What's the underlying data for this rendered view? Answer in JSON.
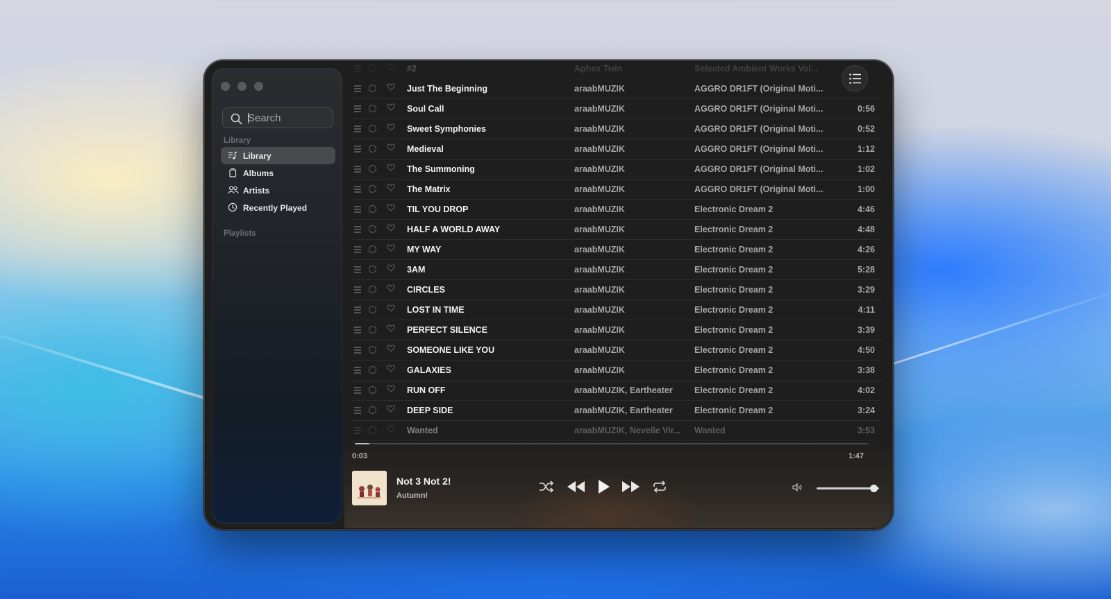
{
  "window": {
    "traffic_lights": [
      "close",
      "minimize",
      "zoom"
    ]
  },
  "sidebar": {
    "search": {
      "placeholder": "Search",
      "value": ""
    },
    "library_heading": "Library",
    "items": [
      {
        "label": "Library",
        "icon": "music-list-icon",
        "active": true
      },
      {
        "label": "Albums",
        "icon": "album-icon",
        "active": false
      },
      {
        "label": "Artists",
        "icon": "artists-icon",
        "active": false
      },
      {
        "label": "Recently Played",
        "icon": "clock-icon",
        "active": false
      }
    ],
    "playlists_heading": "Playlists"
  },
  "tracks": [
    {
      "title": "#2",
      "artist": "Aphex Twin",
      "album": "Selected Ambient Works Vol...",
      "duration": ""
    },
    {
      "title": "Just The Beginning",
      "artist": "araabMUZIK",
      "album": "AGGRO DR1FT (Original Moti...",
      "duration": ""
    },
    {
      "title": "Soul Call",
      "artist": "araabMUZIK",
      "album": "AGGRO DR1FT (Original Moti...",
      "duration": "0:56"
    },
    {
      "title": "Sweet Symphonies",
      "artist": "araabMUZIK",
      "album": "AGGRO DR1FT (Original Moti...",
      "duration": "0:52"
    },
    {
      "title": "Medieval",
      "artist": "araabMUZIK",
      "album": "AGGRO DR1FT (Original Moti...",
      "duration": "1:12"
    },
    {
      "title": "The Summoning",
      "artist": "araabMUZIK",
      "album": "AGGRO DR1FT (Original Moti...",
      "duration": "1:02"
    },
    {
      "title": "The Matrix",
      "artist": "araabMUZIK",
      "album": "AGGRO DR1FT (Original Moti...",
      "duration": "1:00"
    },
    {
      "title": "TIL YOU DROP",
      "artist": "araabMUZIK",
      "album": "Electronic Dream 2",
      "duration": "4:46"
    },
    {
      "title": "HALF A WORLD AWAY",
      "artist": "araabMUZIK",
      "album": "Electronic Dream 2",
      "duration": "4:48"
    },
    {
      "title": "MY WAY",
      "artist": "araabMUZIK",
      "album": "Electronic Dream 2",
      "duration": "4:26"
    },
    {
      "title": "3AM",
      "artist": "araabMUZIK",
      "album": "Electronic Dream 2",
      "duration": "5:28"
    },
    {
      "title": "CIRCLES",
      "artist": "araabMUZIK",
      "album": "Electronic Dream 2",
      "duration": "3:29"
    },
    {
      "title": "LOST IN TIME",
      "artist": "araabMUZIK",
      "album": "Electronic Dream 2",
      "duration": "4:11"
    },
    {
      "title": "PERFECT SILENCE",
      "artist": "araabMUZIK",
      "album": "Electronic Dream 2",
      "duration": "3:39"
    },
    {
      "title": "SOMEONE LIKE YOU",
      "artist": "araabMUZIK",
      "album": "Electronic Dream 2",
      "duration": "4:50"
    },
    {
      "title": "GALAXIES",
      "artist": "araabMUZIK",
      "album": "Electronic Dream 2",
      "duration": "3:38"
    },
    {
      "title": "RUN OFF",
      "artist": "araabMUZIK, Eartheater",
      "album": "Electronic Dream 2",
      "duration": "4:02"
    },
    {
      "title": "DEEP SIDE",
      "artist": "araabMUZIK, Eartheater",
      "album": "Electronic Dream 2",
      "duration": "3:24"
    },
    {
      "title": "Wanted",
      "artist": "araabMUZIK, Nevelle Vir...",
      "album": "Wanted",
      "duration": "3:53"
    }
  ],
  "player": {
    "elapsed": "0:03",
    "total": "1:47",
    "progress_fraction": 0.028,
    "title": "Not 3 Not 2!",
    "artist": "Autumn!",
    "volume_fraction": 0.92,
    "controls": [
      "shuffle-icon",
      "previous-icon",
      "play-icon",
      "next-icon",
      "repeat-icon"
    ]
  },
  "colors": {
    "window_bg": "#1e1e1e",
    "text_primary": "#f2f2f2",
    "text_secondary": "#a6a6a6"
  }
}
